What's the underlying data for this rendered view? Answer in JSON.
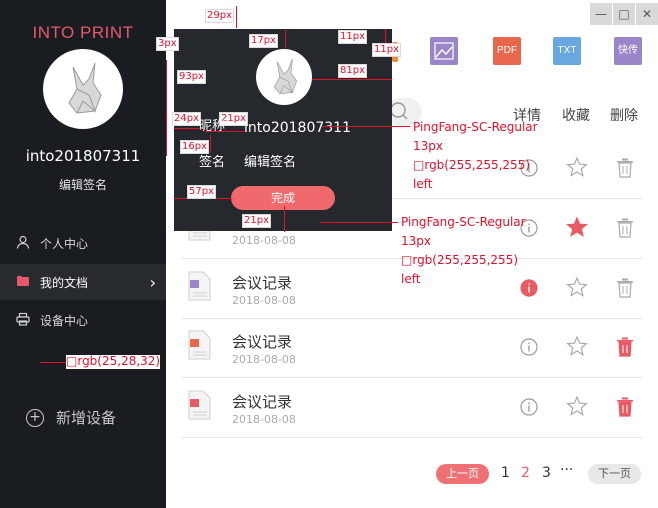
{
  "sidebar": {
    "brand": "INTO PRINT",
    "username": "into201807311",
    "edit_signature": "编辑签名",
    "nav": [
      {
        "label": "个人中心",
        "icon": "person-icon"
      },
      {
        "label": "我的文档",
        "icon": "folder-icon"
      },
      {
        "label": "设备中心",
        "icon": "printer-icon"
      }
    ],
    "add_device": "新增设备"
  },
  "window": {
    "minimize": "—",
    "maximize": "□",
    "close": "✕"
  },
  "toolbar": {
    "pdf": "PDF",
    "txt": "TXT",
    "send": "快传"
  },
  "columns": {
    "detail": "详情",
    "favorite": "收藏",
    "delete": "删除"
  },
  "rows": [
    {
      "title": "",
      "date": "",
      "favorite": false,
      "info_active": false,
      "delete_active": false,
      "type": "doc"
    },
    {
      "title": "",
      "date": "2018-08-08",
      "favorite": true,
      "info_active": false,
      "delete_active": false,
      "type": "doc"
    },
    {
      "title": "会议记录",
      "date": "2018-08-08",
      "favorite": false,
      "info_active": true,
      "delete_active": false,
      "type": "image"
    },
    {
      "title": "会议记录",
      "date": "2018-08-08",
      "favorite": false,
      "info_active": false,
      "delete_active": true,
      "type": "ppt"
    },
    {
      "title": "会议记录",
      "date": "2018-08-08",
      "favorite": false,
      "info_active": false,
      "delete_active": true,
      "type": "pdf"
    }
  ],
  "pagination": {
    "prev": "上一页",
    "pages": [
      "1",
      "2",
      "3"
    ],
    "current": "2",
    "dots": "···",
    "next": "下一页"
  },
  "popup": {
    "username": "into201807311",
    "signature_label": "签名",
    "signature_value": "编辑签名",
    "done": "完成"
  },
  "annotations": {
    "m29": "29px",
    "m3": "3px",
    "m93": "93px",
    "m17": "17px",
    "m11a": "11px",
    "m11b": "11px",
    "m81": "81px",
    "m24": "24px",
    "m21a": "21px",
    "m16": "16px",
    "m57": "57px",
    "m21b": "21px",
    "font1": "PingFang-SC-Regular",
    "size1": "13px",
    "color1": "rgb(255,255,255)",
    "align1": "left",
    "font2": "PingFang-SC-Regular",
    "size2": "13px",
    "color2": "rgb(255,255,255)",
    "align2": "left",
    "sidebar_color": "rgb(25,28,32)",
    "name_fragment": "昵称"
  },
  "colors": {
    "accent": "#f06a6d",
    "sidebar": "#191c20",
    "popup": "#25282d",
    "annotation": "#e0102a"
  }
}
